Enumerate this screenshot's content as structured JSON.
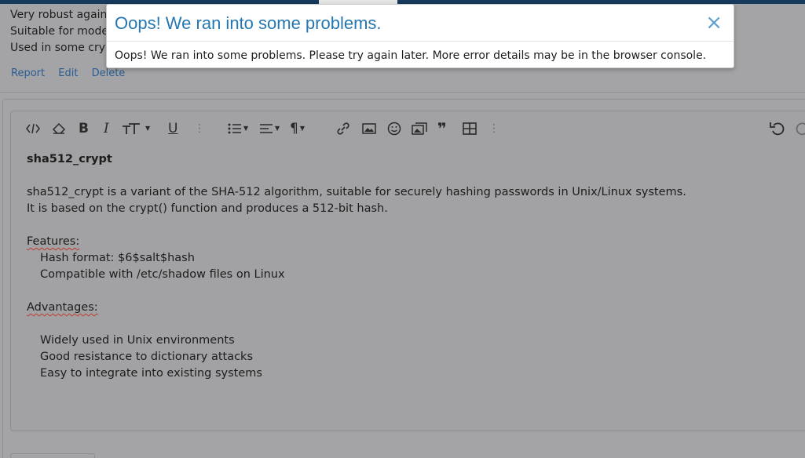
{
  "post": {
    "lines": [
      "Very robust agains",
      "Suitable for moder",
      "Used in some cryp"
    ],
    "actions": {
      "report": "Report",
      "edit": "Edit",
      "delete": "Delete"
    }
  },
  "editor": {
    "toolbar_icons": [
      "code-icon",
      "eraser-icon",
      "bold-icon",
      "italic-icon",
      "text-size-icon",
      "underline-icon",
      "more-icon",
      "list-icon",
      "align-icon",
      "paragraph-icon",
      "link-icon",
      "image-icon",
      "emoji-icon",
      "media-icon",
      "quote-icon",
      "table-icon",
      "more-icon",
      "undo-icon",
      "redo-icon"
    ],
    "content": {
      "title": "sha512_crypt",
      "intro_1": "sha512_crypt is a variant of the SHA-512 algorithm, suitable for securely hashing passwords in Unix/Linux systems.",
      "intro_2": "It is based on the crypt() function and produces a 512-bit hash.",
      "features_heading": "Features:",
      "features": [
        "Hash format: $6$salt$hash",
        "Compatible with /etc/shadow files on Linux"
      ],
      "advantages_heading": "Advantages:",
      "advantages": [
        "Widely used in Unix environments",
        "Good resistance to dictionary attacks",
        "Easy to integrate into existing systems"
      ]
    }
  },
  "modal": {
    "title": "Oops! We ran into some problems.",
    "close": "×",
    "message": "Oops! We ran into some problems. Please try again later. More error details may be in the browser console."
  }
}
